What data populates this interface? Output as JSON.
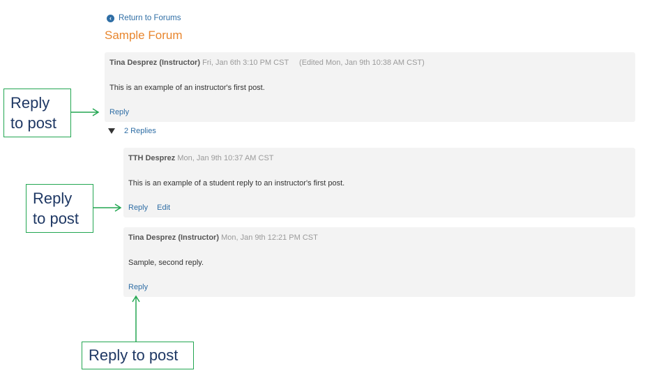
{
  "nav": {
    "back_label": "Return to Forums"
  },
  "forum": {
    "title": "Sample Forum"
  },
  "posts": [
    {
      "author": "Tina Desprez (Instructor)",
      "date": "Fri, Jan 6th 3:10 PM CST",
      "edited": "(Edited Mon, Jan 9th 10:38 AM CST)",
      "body": "This is an example of an instructor's first post.",
      "reply_label": "Reply"
    }
  ],
  "replies_toggle": {
    "label": "2 Replies",
    "state": "expanded"
  },
  "replies": [
    {
      "author": "TTH Desprez",
      "date": "Mon, Jan 9th 10:37 AM CST",
      "body": "This is an example of a student reply to an instructor's first post.",
      "reply_label": "Reply",
      "edit_label": "Edit"
    },
    {
      "author": "Tina Desprez (Instructor)",
      "date": "Mon, Jan 9th 12:21 PM CST",
      "body": "Sample, second reply.",
      "reply_label": "Reply"
    }
  ],
  "annotations": {
    "callout_1_line1": "Reply",
    "callout_1_line2": "to post",
    "callout_2_line1": "Reply",
    "callout_2_line2": "to post",
    "callout_3": "Reply to post"
  },
  "colors": {
    "link": "#2f6ea5",
    "forum_title": "#e8862e",
    "post_bg": "#f3f3f3",
    "callout_border": "#22a651",
    "callout_text": "#1f3864"
  },
  "icons": {
    "back": "chevron-left-circle-icon",
    "toggle": "triangle-down-icon"
  }
}
